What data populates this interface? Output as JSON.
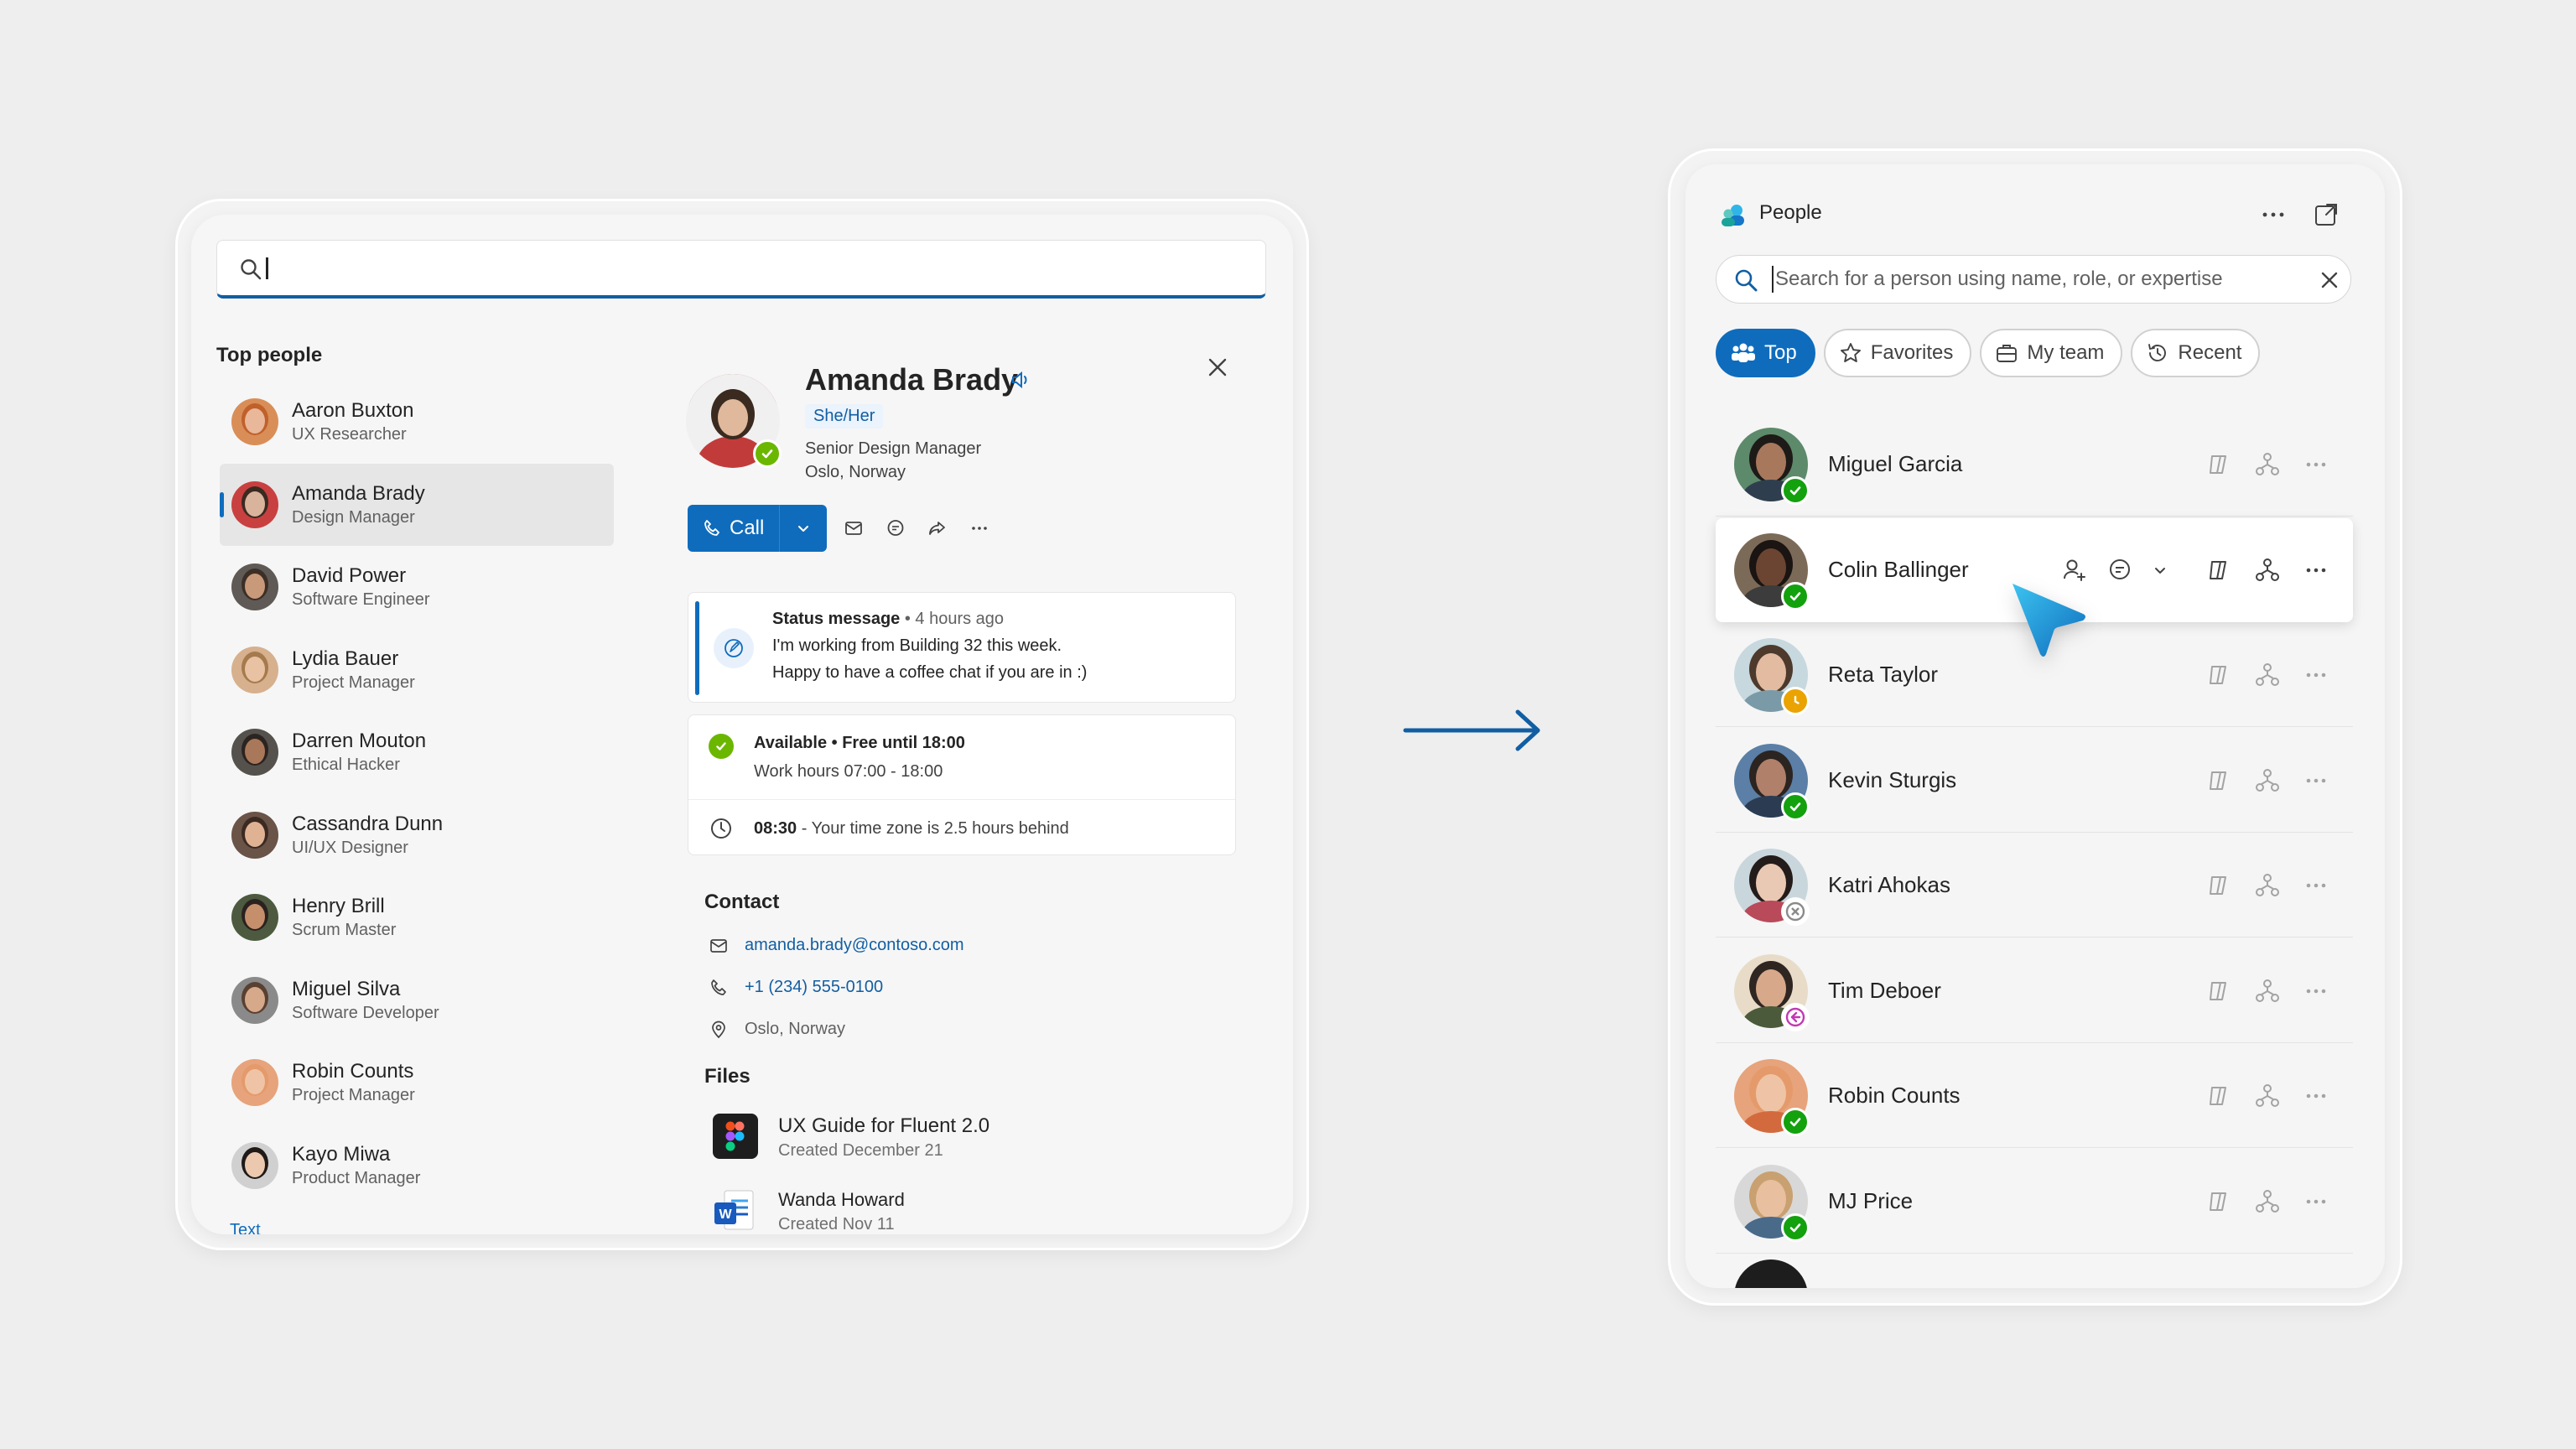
{
  "left": {
    "search": {
      "value": ""
    },
    "top_people_title": "Top people",
    "people": [
      {
        "name": "Aaron Buxton",
        "role": "UX Researcher",
        "skin": "#e9b79a",
        "hair": "#c0602a",
        "bg": "#d98e58"
      },
      {
        "name": "Amanda Brady",
        "role": "Design Manager",
        "skin": "#d9b39c",
        "hair": "#3a2a20",
        "bg": "#c94040"
      },
      {
        "name": "David Power",
        "role": "Software Engineer",
        "skin": "#c99a7a",
        "hair": "#3c2f26",
        "bg": "#5f5a56"
      },
      {
        "name": "Lydia Bauer",
        "role": "Project Manager",
        "skin": "#e8c2a3",
        "hair": "#a57a4c",
        "bg": "#d7b08e"
      },
      {
        "name": "Darren Mouton",
        "role": "Ethical Hacker",
        "skin": "#a9785a",
        "hair": "#2b2420",
        "bg": "#55524d"
      },
      {
        "name": "Cassandra Dunn",
        "role": "UI/UX Designer",
        "skin": "#e0b294",
        "hair": "#3b2a22",
        "bg": "#6a5347"
      },
      {
        "name": "Henry Brill",
        "role": "Scrum Master",
        "skin": "#c68f6c",
        "hair": "#2a2220",
        "bg": "#4d5a3f"
      },
      {
        "name": "Miguel Silva",
        "role": "Software Developer",
        "skin": "#d5a98a",
        "hair": "#5a4032",
        "bg": "#8a8a8a"
      },
      {
        "name": "Robin Counts",
        "role": "Project Manager",
        "skin": "#efc4a6",
        "hair": "#e59a6b",
        "bg": "#e7a37b"
      },
      {
        "name": "Kayo Miwa",
        "role": "Product Manager",
        "skin": "#ecc9ae",
        "hair": "#1f1a18",
        "bg": "#d0d0d0"
      }
    ],
    "list_more": "Text",
    "profile": {
      "name": "Amanda Brady",
      "pronouns": "She/Her",
      "title": "Senior Design Manager",
      "location": "Oslo, Norway",
      "call_label": "Call",
      "status_heading": "Status message",
      "status_time": " • 4 hours ago",
      "status_line1": "I'm working from Building 32 this week.",
      "status_line2": "Happy to have a coffee chat if you are in :)",
      "availability": "Available • Free until 18:00",
      "work_hours": "Work hours 07:00 - 18:00",
      "tz_time": "08:30",
      "tz_text": " - Your time zone is 2.5 hours behind",
      "contact_title": "Contact",
      "email": "amanda.brady@contoso.com",
      "phone": "+1 (234) 555-0100",
      "address": "Oslo, Norway",
      "files_title": "Files",
      "files": [
        {
          "name": "UX Guide for Fluent 2.0",
          "sub": "Created December 21"
        },
        {
          "name": "Wanda Howard",
          "sub": "Created Nov 11"
        }
      ]
    }
  },
  "right": {
    "app_title": "People",
    "search": {
      "placeholder": "Search for a person using name, role, or expertise"
    },
    "pills": [
      {
        "label": "Top",
        "icon": "people-team-icon",
        "active": true
      },
      {
        "label": "Favorites",
        "icon": "star-icon",
        "active": false
      },
      {
        "label": "My team",
        "icon": "briefcase-icon",
        "active": false
      },
      {
        "label": "Recent",
        "icon": "history-icon",
        "active": false
      }
    ],
    "people": [
      {
        "name": "Miguel Garcia",
        "presence": "available",
        "skin": "#a8785c",
        "hair": "#1e1a18",
        "bg": "#5c8a6a",
        "shirt": "#2f3e4f"
      },
      {
        "name": "Colin Ballinger",
        "presence": "available",
        "skin": "#6b4532",
        "hair": "#1a1412",
        "bg": "#7c6a58",
        "shirt": "#3c3c3c"
      },
      {
        "name": "Reta Taylor",
        "presence": "away",
        "skin": "#e2bba0",
        "hair": "#4d3a2c",
        "bg": "#c7d8de",
        "shirt": "#7a9aa8"
      },
      {
        "name": "Kevin Sturgis",
        "presence": "available",
        "skin": "#b0806a",
        "hair": "#2b2420",
        "bg": "#5b7fa6",
        "shirt": "#2a3b52"
      },
      {
        "name": "Katri Ahokas",
        "presence": "offline",
        "skin": "#eac9b4",
        "hair": "#241c1a",
        "bg": "#c9d7dd",
        "shirt": "#b94a5a"
      },
      {
        "name": "Tim Deboer",
        "presence": "out-of-office",
        "skin": "#d7a98a",
        "hair": "#2f2622",
        "bg": "#e8dcc8",
        "shirt": "#4a5a3a"
      },
      {
        "name": "Robin Counts",
        "presence": "available",
        "skin": "#efc4a6",
        "hair": "#e59a6b",
        "bg": "#e7a37b",
        "shirt": "#d36a3e"
      },
      {
        "name": "MJ Price",
        "presence": "available",
        "skin": "#e8c0a0",
        "hair": "#c9a070",
        "bg": "#d8d8d8",
        "shirt": "#4a6a8a"
      }
    ],
    "colors": {
      "accent": "#0f6cbd",
      "available": "#13a10e",
      "away": "#eaa300",
      "offline": "#8a8a8a",
      "out_of_office": "#c239b3"
    }
  }
}
